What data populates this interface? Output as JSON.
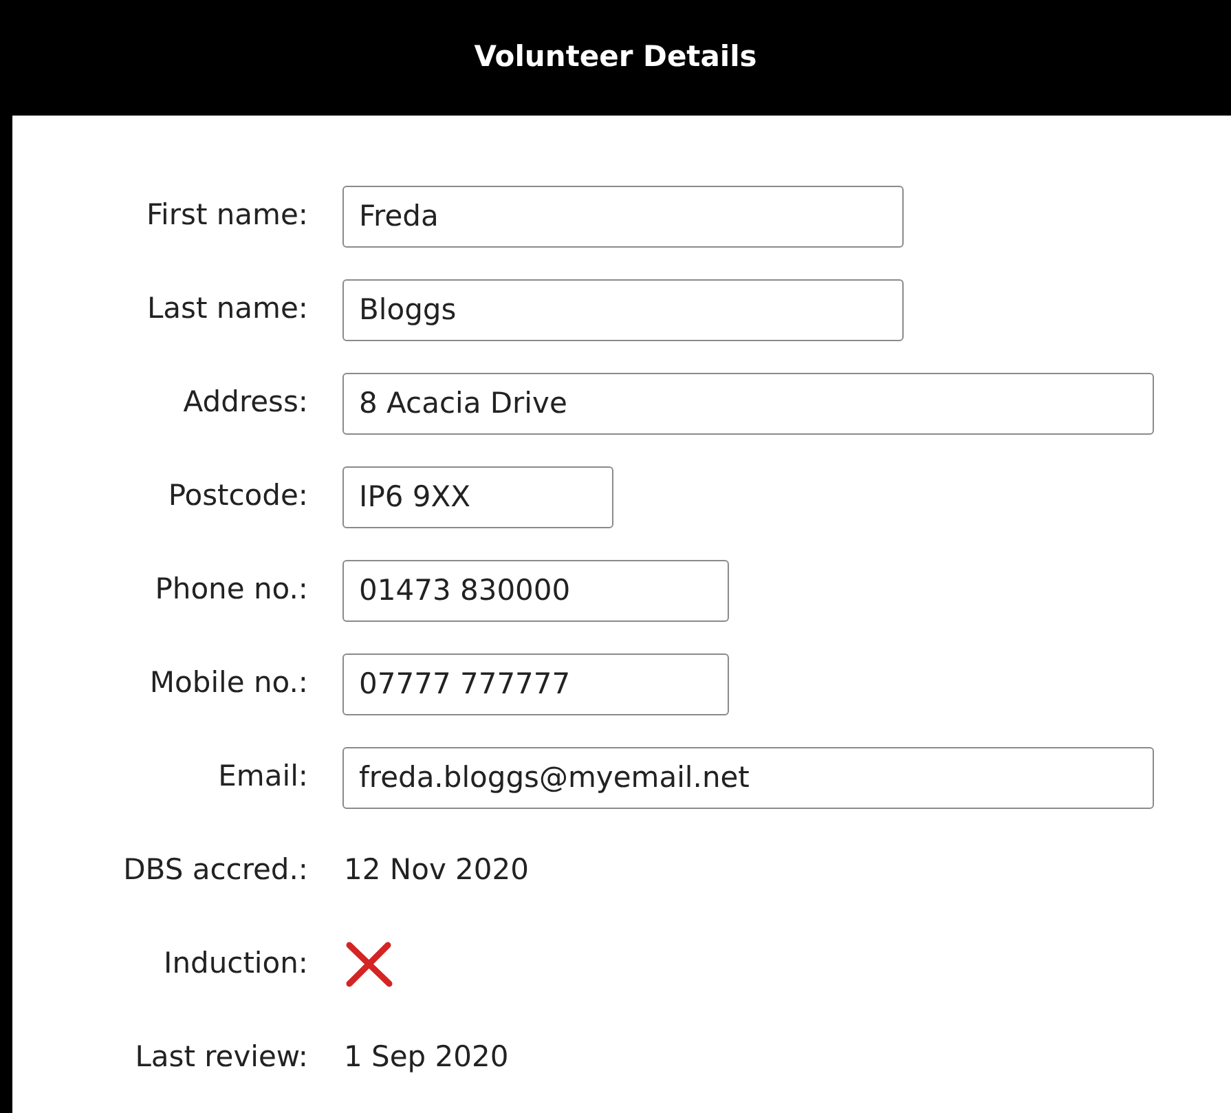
{
  "title": "Volunteer Details",
  "fields": [
    {
      "kind": "input",
      "label": "First name:",
      "value": "Freda"
    },
    {
      "kind": "input",
      "label": "Last name:",
      "value": "Bloggs"
    },
    {
      "kind": "input",
      "label": "Address:",
      "value": "8 Acacia Drive"
    },
    {
      "kind": "input",
      "label": "Postcode:",
      "value": "IP6 9XX"
    },
    {
      "kind": "input",
      "label": "Phone no.:",
      "value": "01473 830000"
    },
    {
      "kind": "input",
      "label": "Mobile no.:",
      "value": "07777 777777"
    },
    {
      "kind": "input",
      "label": "Email:",
      "value": "freda.bloggs@myemail.net"
    },
    {
      "kind": "text",
      "label": "DBS accred.:",
      "value": "12 Nov 2020"
    },
    {
      "kind": "status",
      "label": "Induction:",
      "done": false
    },
    {
      "kind": "text",
      "label": "Last review:",
      "value": "1 Sep 2020"
    }
  ]
}
